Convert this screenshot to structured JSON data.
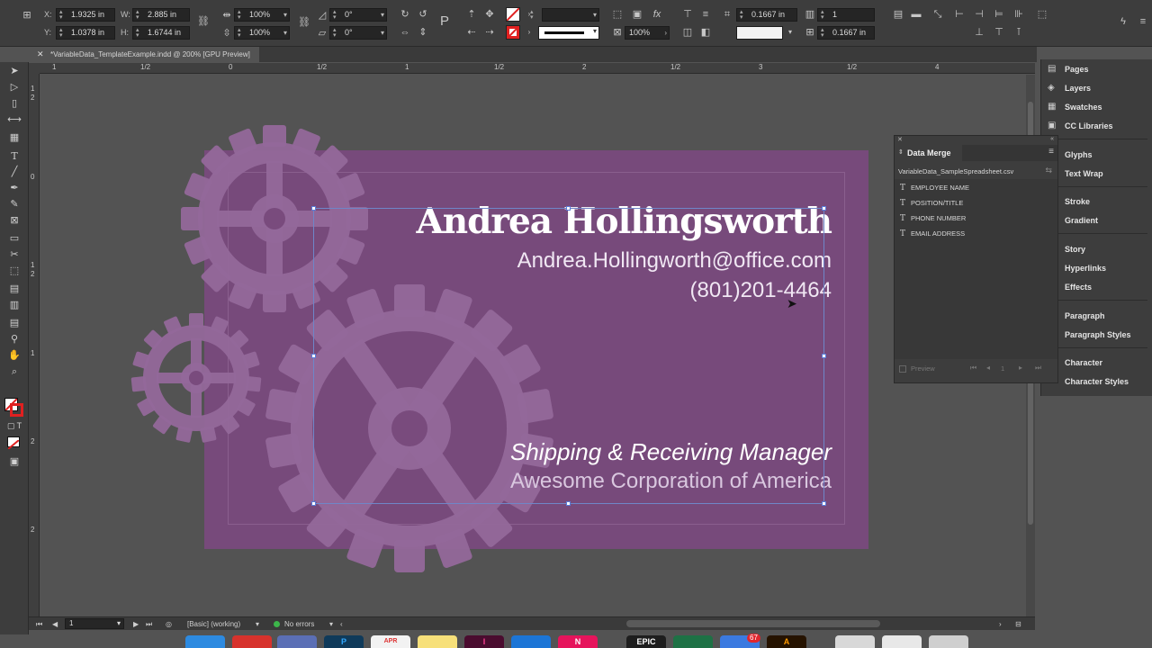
{
  "document_tab": {
    "title": "*VariableData_TemplateExample.indd @ 200% [GPU Preview]"
  },
  "control_bar": {
    "x_label": "X:",
    "x_value": "1.9325 in",
    "y_label": "Y:",
    "y_value": "1.0378 in",
    "w_label": "W:",
    "w_value": "2.885 in",
    "h_label": "H:",
    "h_value": "1.6744 in",
    "scale_x": "100%",
    "scale_y": "100%",
    "rotate": "0°",
    "shear": "0°",
    "opacity": "100%",
    "stroke_weight_1": "0.1667 in",
    "stroke_weight_2": "0.1667 in",
    "columns": "1"
  },
  "rulers": {
    "horizontal": [
      "1",
      "1/2",
      "0",
      "1/2",
      "1",
      "1/2",
      "2",
      "1/2",
      "3",
      "1/2",
      "4"
    ],
    "vertical": [
      "1",
      "2",
      "0",
      "1",
      "2",
      "1",
      "2",
      "2"
    ]
  },
  "card": {
    "name": "Andrea Hollingsworth",
    "email": "Andrea.Hollingworth@office.com",
    "phone": "(801)201-4464",
    "title": "Shipping & Receiving Manager",
    "company": "Awesome Corporation of America"
  },
  "status_bar": {
    "page": "1",
    "profile": "[Basic] (working)",
    "errors": "No errors"
  },
  "panels_dock": {
    "items": [
      "Pages",
      "Layers",
      "Swatches",
      "CC Libraries",
      "Glyphs",
      "Text Wrap",
      "Stroke",
      "Gradient",
      "Story",
      "Hyperlinks",
      "Effects",
      "Paragraph",
      "Paragraph Styles",
      "Character",
      "Character Styles"
    ]
  },
  "data_merge": {
    "title": "Data Merge",
    "source_file": "VariableData_SampleSpreadsheet.csv",
    "fields": [
      "EMPLOYEE NAME",
      "POSITION/TITLE",
      "PHONE NUMBER",
      "EMAIL ADDRESS"
    ],
    "preview_label": "Preview",
    "record": "1"
  },
  "mac_dock": {
    "calendar_month": "APR",
    "mail_badge": "67",
    "epic_label": "EPIC"
  },
  "colors": {
    "card_background": "#774a7b",
    "gear_fill": "#93689a",
    "selection_frame": "#6f86c8",
    "panel_bg": "#3d3d3d"
  }
}
